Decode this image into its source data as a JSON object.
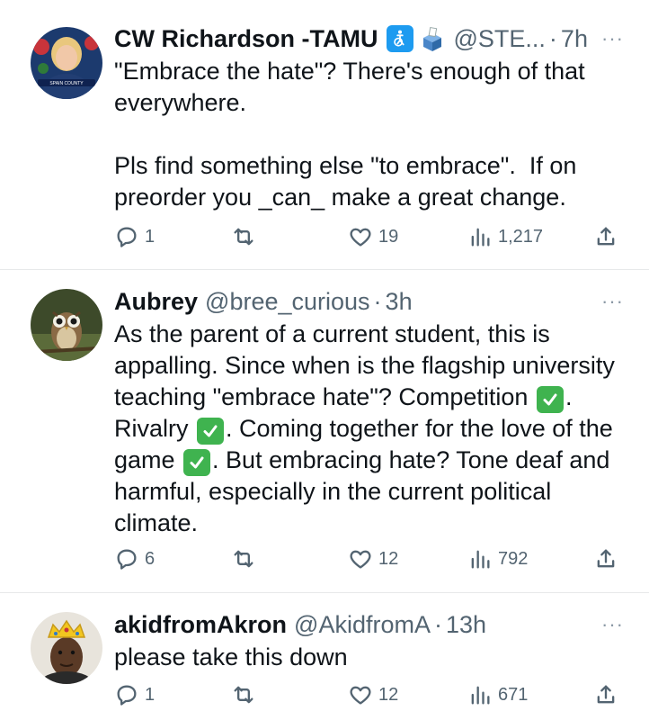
{
  "tweets": [
    {
      "name": "CW Richardson -TAMU",
      "handle": "@STE...",
      "dot": "·",
      "time": "7h",
      "text": "\"Embrace the hate\"? There's enough of that everywhere.\n\nPls find something else \"to embrace\".  If on preorder you _can_ make a great change.",
      "replies": "1",
      "retweets": "",
      "likes": "19",
      "views": "1,217",
      "avatar_label": "SPAIN COUNTY"
    },
    {
      "name": "Aubrey",
      "handle": "@bree_curious",
      "dot": "·",
      "time": "3h",
      "text_parts": [
        "As the parent of a current student, this is appalling. Since when is the flagship university teaching \"embrace hate\"? Competition ",
        ". Rivalry ",
        ". Coming together for the love of the game ",
        ". But embracing hate? Tone deaf and harmful, especially in the current political climate."
      ],
      "replies": "6",
      "retweets": "",
      "likes": "12",
      "views": "792"
    },
    {
      "name": "akidfromAkron",
      "handle": "@AkidfromA",
      "dot": "·",
      "time": "13h",
      "text": "please take this down",
      "replies": "1",
      "retweets": "",
      "likes": "12",
      "views": "671"
    }
  ],
  "more_label": "···",
  "icons": {
    "reply": "reply-icon",
    "retweet": "retweet-icon",
    "like": "heart-icon",
    "views": "views-icon",
    "share": "share-icon",
    "more": "more-icon",
    "accessibility": "accessibility-badge-icon",
    "ballot": "ballot-box-icon",
    "check": "check-mark-icon"
  },
  "colors": {
    "accent": "#1d9bf0",
    "muted": "#536471",
    "check": "#3fb34f"
  }
}
